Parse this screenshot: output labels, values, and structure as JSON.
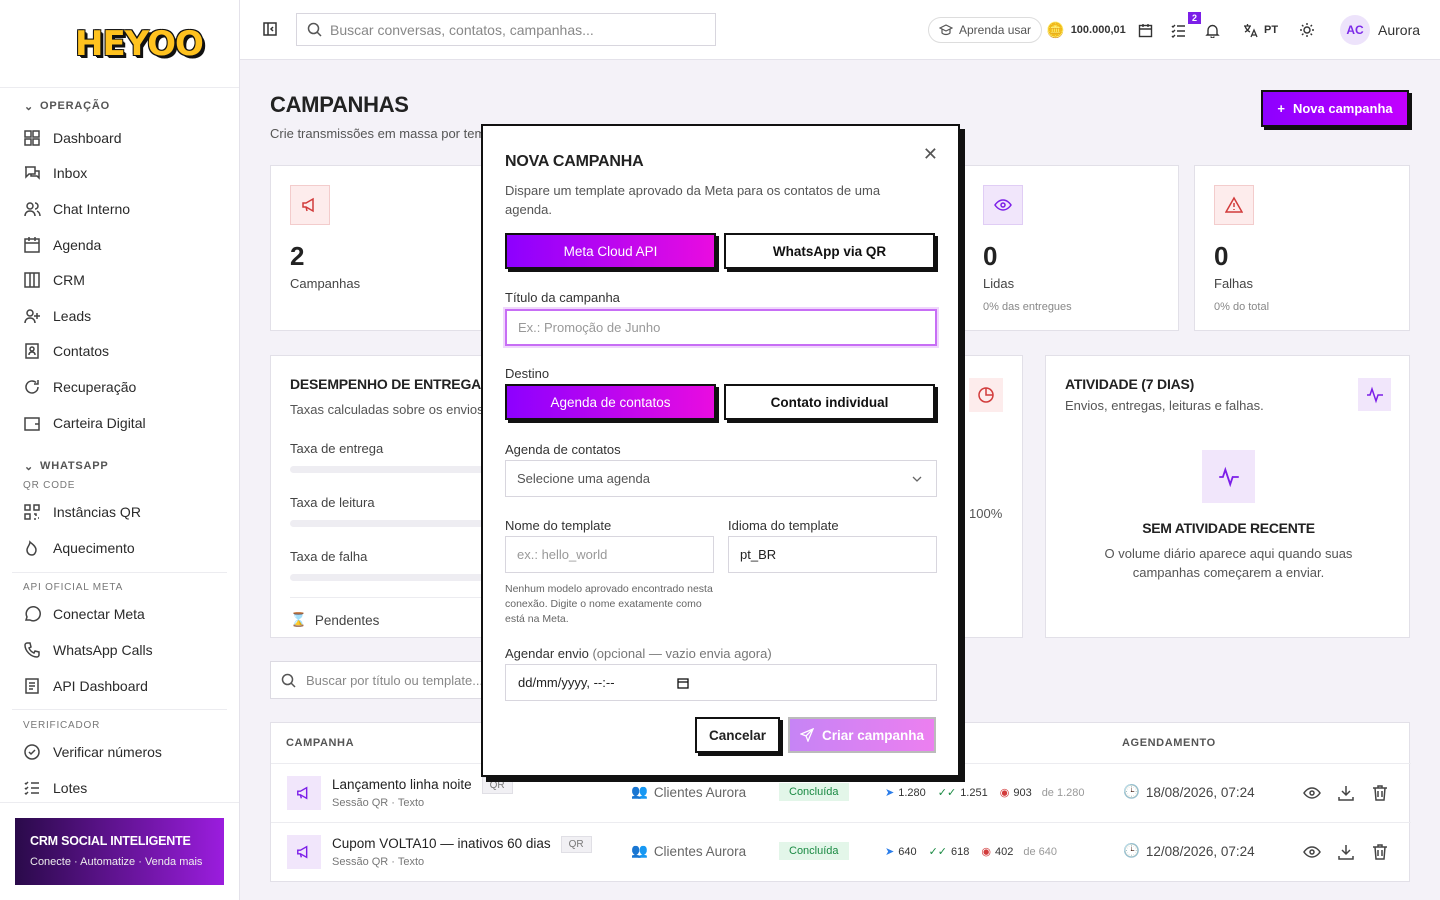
{
  "brand": {
    "logo": "HEYOO"
  },
  "sidebar": {
    "sections": [
      {
        "title": "OPERAÇÃO",
        "items": [
          "Dashboard",
          "Inbox",
          "Chat Interno",
          "Agenda",
          "CRM",
          "Leads",
          "Contatos",
          "Recuperação",
          "Carteira Digital"
        ]
      },
      {
        "title": "WHATSAPP",
        "subtitle": "QR CODE",
        "items": [
          "Instâncias QR",
          "Aquecimento"
        ]
      },
      {
        "subtitle": "API OFICIAL META",
        "items": [
          "Conectar Meta",
          "WhatsApp Calls",
          "API Dashboard"
        ]
      },
      {
        "subtitle": "VERIFICADOR",
        "items": [
          "Verificar números",
          "Lotes"
        ]
      }
    ],
    "promo": {
      "title": "CRM SOCIAL INTELIGENTE",
      "subtitle": "Conecte · Automatize · Venda mais"
    }
  },
  "topbar": {
    "search_placeholder": "Buscar conversas, contatos, campanhas...",
    "learn": "Aprenda usar",
    "balance": "100.000,01",
    "tasks_badge": "2",
    "lang": "PT",
    "user_initials": "AC",
    "user_name": "Aurora"
  },
  "page": {
    "title": "CAMPANHAS",
    "subtitle": "Crie transmissões em massa por tem",
    "new_button": "Nova campanha"
  },
  "stats": [
    {
      "value": "2",
      "label": "Campanhas",
      "sub": ""
    },
    {
      "value": "0",
      "label": "Lidas",
      "sub": "0% das entregues"
    },
    {
      "value": "0",
      "label": "Falhas",
      "sub": "0% do total"
    }
  ],
  "performance": {
    "title": "DESEMPENHO DE ENTREGA",
    "subtitle": "Taxas calculadas sobre os envios.",
    "rates": [
      "Taxa de entrega",
      "Taxa de leitura",
      "Taxa de falha"
    ],
    "pending": "Pendentes",
    "pct": "100%"
  },
  "activity": {
    "title": "ATIVIDADE (7 DIAS)",
    "subtitle": "Envios, entregas, leituras e falhas.",
    "empty_title": "SEM ATIVIDADE RECENTE",
    "empty_text": "O volume diário aparece aqui quando suas campanhas começarem a enviar."
  },
  "list": {
    "search_placeholder": "Buscar por título ou template...",
    "headers": {
      "campaign": "CAMPANHA",
      "schedule": "AGENDAMENTO"
    },
    "rows": [
      {
        "name": "Lançamento linha noite",
        "tag": "QR",
        "meta": "Sessão QR · Texto",
        "audience": "Clientes Aurora",
        "status": "Concluída",
        "sent": "1.280",
        "delivered": "1.251",
        "read": "903",
        "of": "de 1.280",
        "schedule": "18/08/2026, 07:24"
      },
      {
        "name": "Cupom VOLTA10 — inativos 60 dias",
        "tag": "QR",
        "meta": "Sessão QR · Texto",
        "audience": "Clientes Aurora",
        "status": "Concluída",
        "sent": "640",
        "delivered": "618",
        "read": "402",
        "of": "de 640",
        "schedule": "12/08/2026, 07:24"
      }
    ]
  },
  "modal": {
    "title": "NOVA CAMPANHA",
    "description": "Dispare um template aprovado da Meta para os contatos de uma agenda.",
    "provider_options": [
      "Meta Cloud API",
      "WhatsApp via QR"
    ],
    "title_label": "Título da campanha",
    "title_placeholder": "Ex.: Promoção de Junho",
    "dest_label": "Destino",
    "dest_options": [
      "Agenda de contatos",
      "Contato individual"
    ],
    "agenda_label": "Agenda de contatos",
    "agenda_value": "Selecione uma agenda",
    "template_label": "Nome do template",
    "template_placeholder": "ex.: hello_world",
    "lang_label": "Idioma do template",
    "lang_value": "pt_BR",
    "help": "Nenhum modelo aprovado encontrado nesta conexão. Digite o nome exatamente como está na Meta.",
    "schedule_label": "Agendar envio",
    "schedule_hint": "(opcional — vazio envia agora)",
    "schedule_placeholder": "dd/mm/yyyy, --:--",
    "cancel": "Cancelar",
    "create": "Criar campanha"
  }
}
